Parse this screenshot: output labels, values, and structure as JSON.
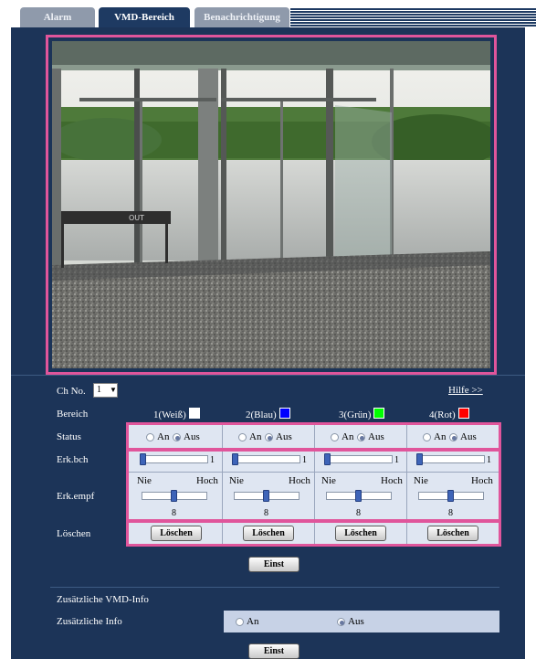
{
  "tabs": [
    {
      "label": "Alarm",
      "active": false
    },
    {
      "label": "VMD-Bereich",
      "active": true
    },
    {
      "label": "Benachrichtigung",
      "active": false
    }
  ],
  "camera": {
    "sign_text": "OUT"
  },
  "ch_no": {
    "label": "Ch No.",
    "value": "1"
  },
  "help_link": "Hilfe >>",
  "table": {
    "bereich_label": "Bereich",
    "status_label": "Status",
    "erk_bch_label": "Erk.bch",
    "erk_empf_label": "Erk.empf",
    "loeschen_label": "Löschen",
    "on_label": "An",
    "off_label": "Aus",
    "low_label": "Nie",
    "high_label": "Hoch",
    "delete_button": "Löschen",
    "areas": [
      {
        "name": "1(Weiß)",
        "color": "#ffffff",
        "status": "Aus",
        "erk_bch": "1",
        "erk_bch_level": 0,
        "erk_empf": "8",
        "erk_empf_level": 0.5
      },
      {
        "name": "2(Blau)",
        "color": "#0000ff",
        "status": "Aus",
        "erk_bch": "1",
        "erk_bch_level": 0,
        "erk_empf": "8",
        "erk_empf_level": 0.5
      },
      {
        "name": "3(Grün)",
        "color": "#00ff00",
        "status": "Aus",
        "erk_bch": "1",
        "erk_bch_level": 0,
        "erk_empf": "8",
        "erk_empf_level": 0.5
      },
      {
        "name": "4(Rot)",
        "color": "#ff0000",
        "status": "Aus",
        "erk_bch": "1",
        "erk_bch_level": 0,
        "erk_empf": "8",
        "erk_empf_level": 0.5
      }
    ]
  },
  "set_button_1": "Einst",
  "extra": {
    "section_title": "Zusätzliche VMD-Info",
    "row_label": "Zusätzliche Info",
    "on_label": "An",
    "off_label": "Aus",
    "selected": "Aus"
  },
  "set_button_2": "Einst",
  "colors": {
    "panel": "#1c3458",
    "highlight": "#e0559b",
    "row": "#c7d2e6"
  }
}
